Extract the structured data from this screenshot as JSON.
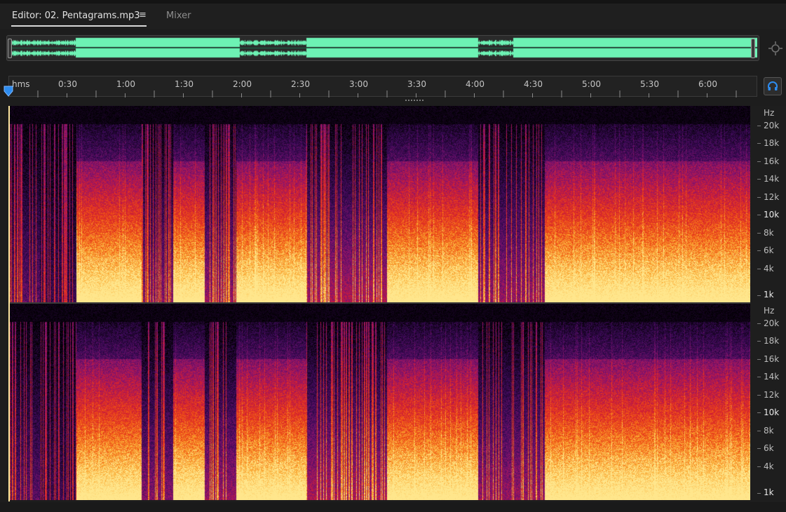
{
  "tabs": {
    "editor_label": "Editor: 02. Pentagrams.mp3",
    "menu_glyph": "≡",
    "mixer_label": "Mixer"
  },
  "ruler": {
    "unit_label": "hms",
    "labels": [
      "0:30",
      "1:00",
      "1:30",
      "2:00",
      "2:30",
      "3:00",
      "3:30",
      "4:00",
      "4:30",
      "5:00",
      "5:30",
      "6:00"
    ]
  },
  "frequency_scale": {
    "unit": "Hz",
    "labels": [
      "20k",
      "18k",
      "16k",
      "14k",
      "12k",
      "10k",
      "8k",
      "6k",
      "4k",
      "1k"
    ],
    "emphasized": [
      "10k",
      "1k"
    ]
  },
  "colors": {
    "waveform": "#6df2b4",
    "accent": "#1a73e8",
    "playhead": "#2d8cf0"
  },
  "icons": {
    "zoom": "zoom-to-selection-icon",
    "monitor": "headphones-icon",
    "menu": "hamburger-menu-icon"
  },
  "chart_data": {
    "type": "heatmap",
    "xlabel": "hms",
    "ylabel": "Hz",
    "x_ticks": [
      "0:30",
      "1:00",
      "1:30",
      "2:00",
      "2:30",
      "3:00",
      "3:30",
      "4:00",
      "4:30",
      "5:00",
      "5:30",
      "6:00"
    ],
    "y_ticks": [
      "20k",
      "18k",
      "16k",
      "14k",
      "12k",
      "10k",
      "8k",
      "6k",
      "4k",
      "1k"
    ],
    "channels": 2
  }
}
